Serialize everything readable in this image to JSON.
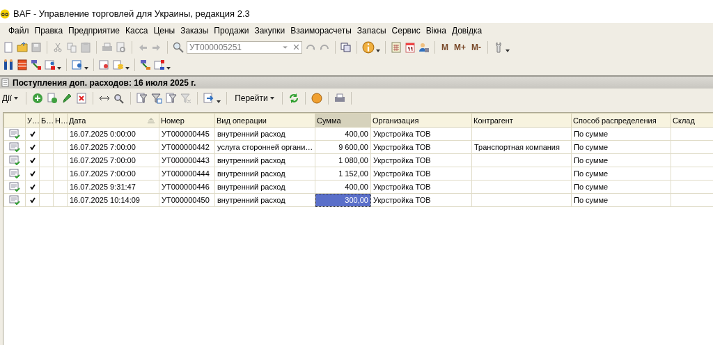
{
  "window": {
    "title": "BAF - Управление торговлей для Украины, редакция 2.3"
  },
  "menu": [
    "Файл",
    "Правка",
    "Предприятие",
    "Касса",
    "Цены",
    "Заказы",
    "Продажи",
    "Закупки",
    "Взаиморасчеты",
    "Запасы",
    "Сервис",
    "Вікна",
    "Довідка"
  ],
  "toolbar": {
    "search": {
      "value": "УТ000005251"
    },
    "memory_buttons": [
      "M",
      "M+",
      "M-"
    ]
  },
  "form": {
    "title": "Поступления доп. расходов: 16 июля 2025 г.",
    "actions_button": "Дії",
    "goto_button": "Перейти"
  },
  "table": {
    "columns": [
      {
        "sorted": false,
        "current": false
      },
      {
        "label": "У…",
        "sorted": false,
        "current": false
      },
      {
        "label": "Б…",
        "sorted": false,
        "current": false
      },
      {
        "label": "Н…",
        "sorted": false,
        "current": false
      },
      {
        "label": "Дата",
        "sorted": true,
        "current": false
      },
      {
        "label": "Номер",
        "sorted": false,
        "current": false
      },
      {
        "label": "Вид операции",
        "sorted": false,
        "current": false
      },
      {
        "label": "Сумма",
        "sorted": false,
        "current": true
      },
      {
        "label": "Организация",
        "sorted": false,
        "current": false
      },
      {
        "label": "Контрагент",
        "sorted": false,
        "current": false
      },
      {
        "label": "Способ распределения",
        "sorted": false,
        "current": false
      },
      {
        "label": "Склад",
        "sorted": false,
        "current": false
      }
    ],
    "rows": [
      {
        "posted": true,
        "selected": false,
        "date": "16.07.2025 0:00:00",
        "number": "УТ000000445",
        "operation": "внутренний расход",
        "sum": "400,00",
        "organization": "Укрстройка ТОВ",
        "counterparty": "",
        "distribution": "По сумме"
      },
      {
        "posted": true,
        "selected": false,
        "date": "16.07.2025 7:00:00",
        "number": "УТ000000442",
        "operation": "услуга сторонней органи…",
        "sum": "9 600,00",
        "organization": "Укрстройка ТОВ",
        "counterparty": "Транспортная компания",
        "distribution": "По сумме"
      },
      {
        "posted": true,
        "selected": false,
        "date": "16.07.2025 7:00:00",
        "number": "УТ000000443",
        "operation": "внутренний расход",
        "sum": "1 080,00",
        "organization": "Укрстройка ТОВ",
        "counterparty": "",
        "distribution": "По сумме"
      },
      {
        "posted": true,
        "selected": false,
        "date": "16.07.2025 7:00:00",
        "number": "УТ000000444",
        "operation": "внутренний расход",
        "sum": "1 152,00",
        "organization": "Укрстройка ТОВ",
        "counterparty": "",
        "distribution": "По сумме"
      },
      {
        "posted": true,
        "selected": false,
        "date": "16.07.2025 9:31:47",
        "number": "УТ000000446",
        "operation": "внутренний расход",
        "sum": "400,00",
        "organization": "Укрстройка ТОВ",
        "counterparty": "",
        "distribution": "По сумме"
      },
      {
        "posted": true,
        "selected": true,
        "date": "16.07.2025 10:14:09",
        "number": "УТ000000450",
        "operation": "внутренний расход",
        "sum": "300,00",
        "organization": "Укрстройка ТОВ",
        "counterparty": "",
        "distribution": "По сумме"
      }
    ]
  }
}
